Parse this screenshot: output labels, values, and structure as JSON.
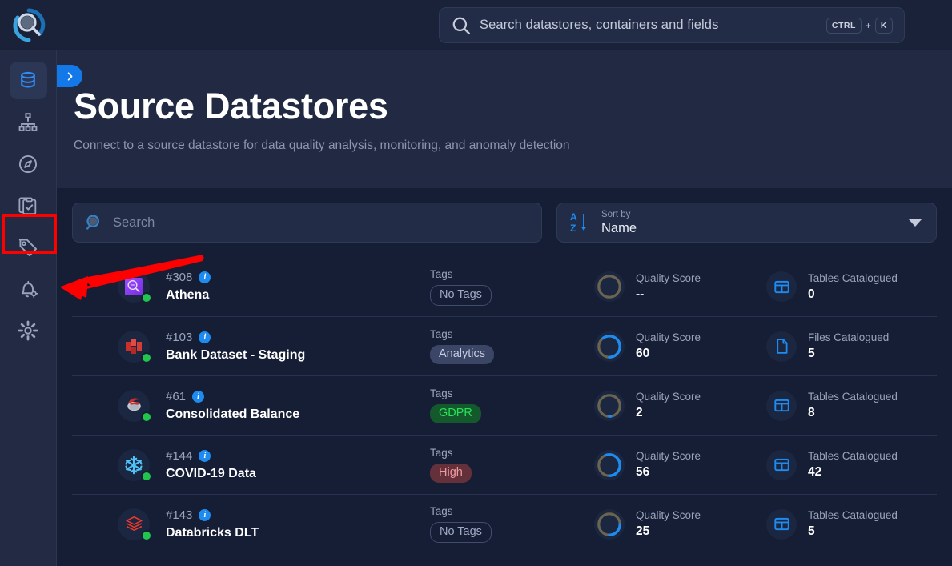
{
  "header": {
    "logo_icon": "magnifier-logo-icon",
    "search": {
      "icon": "search-icon",
      "placeholder": "Search datastores, containers and fields",
      "shortcut_key": "CTRL",
      "shortcut_plus": "+",
      "shortcut_key2": "K"
    }
  },
  "sidebar": {
    "items": [
      {
        "name": "datastores",
        "icon": "database-icon",
        "active": true
      },
      {
        "name": "containers",
        "icon": "sitemap-icon",
        "active": false
      },
      {
        "name": "explore",
        "icon": "compass-icon",
        "active": false
      },
      {
        "name": "checks",
        "icon": "clipboard-check-icon",
        "active": false
      },
      {
        "name": "tags",
        "icon": "tag-icon",
        "active": false
      },
      {
        "name": "notifications",
        "icon": "bell-gear-icon",
        "active": false,
        "highlighted": true
      },
      {
        "name": "settings",
        "icon": "gear-icon",
        "active": false
      }
    ]
  },
  "hero": {
    "collapse_icon": "chevron-right-icon",
    "title": "Source Datastores",
    "subtitle": "Connect to a source datastore for data quality analysis, monitoring, and anomaly detection"
  },
  "controls": {
    "search": {
      "icon": "search-icon",
      "placeholder": "Search",
      "value": ""
    },
    "sort": {
      "icon": "sort-az-icon",
      "label": "Sort by",
      "value": "Name",
      "caret_icon": "chevron-down-icon"
    }
  },
  "columns": {
    "tags_label": "Tags",
    "score_label": "Quality Score",
    "tables_label": "Tables Catalogued",
    "files_label": "Files Catalogued"
  },
  "annotation": {
    "box_color": "#ff0000",
    "arrow_color": "#ff0000"
  },
  "accent": {
    "blue": "#1e8bf0",
    "panel_bg": "#161e36",
    "page_bg": "#212a42",
    "topbar_bg": "#1a2239",
    "sidebar_bg": "#222b43",
    "green_status": "#21c44d"
  },
  "rows": [
    {
      "id": "#308",
      "name": "Athena",
      "info_icon": "info-icon",
      "datastore_icon": "aws-athena-icon",
      "status": "online",
      "tags_label": "Tags",
      "tag": "No Tags",
      "tag_style": "none",
      "score_label": "Quality Score",
      "score": "--",
      "score_percent": 0,
      "catalog_icon": "table-icon",
      "catalog_label": "Tables Catalogued",
      "catalog_value": "0"
    },
    {
      "id": "#103",
      "name": "Bank Dataset - Staging",
      "info_icon": "info-icon",
      "datastore_icon": "aws-rds-icon",
      "status": "online",
      "tags_label": "Tags",
      "tag": "Analytics",
      "tag_style": "analytics",
      "score_label": "Quality Score",
      "score": "60",
      "score_percent": 60,
      "catalog_icon": "file-icon",
      "catalog_label": "Files Catalogued",
      "catalog_value": "5"
    },
    {
      "id": "#61",
      "name": "Consolidated Balance",
      "info_icon": "info-icon",
      "datastore_icon": "microsoft-sql-server-icon",
      "status": "online",
      "tags_label": "Tags",
      "tag": "GDPR",
      "tag_style": "gdpr",
      "score_label": "Quality Score",
      "score": "2",
      "score_percent": 2,
      "catalog_icon": "table-icon",
      "catalog_label": "Tables Catalogued",
      "catalog_value": "8"
    },
    {
      "id": "#144",
      "name": "COVID-19 Data",
      "info_icon": "info-icon",
      "datastore_icon": "snowflake-icon",
      "status": "online",
      "tags_label": "Tags",
      "tag": "High",
      "tag_style": "high",
      "score_label": "Quality Score",
      "score": "56",
      "score_percent": 56,
      "catalog_icon": "table-icon",
      "catalog_label": "Tables Catalogued",
      "catalog_value": "42"
    },
    {
      "id": "#143",
      "name": "Databricks DLT",
      "info_icon": "info-icon",
      "datastore_icon": "databricks-icon",
      "status": "online",
      "tags_label": "Tags",
      "tag": "No Tags",
      "tag_style": "none",
      "score_label": "Quality Score",
      "score": "25",
      "score_percent": 25,
      "catalog_icon": "table-icon",
      "catalog_label": "Tables Catalogued",
      "catalog_value": "5"
    }
  ]
}
